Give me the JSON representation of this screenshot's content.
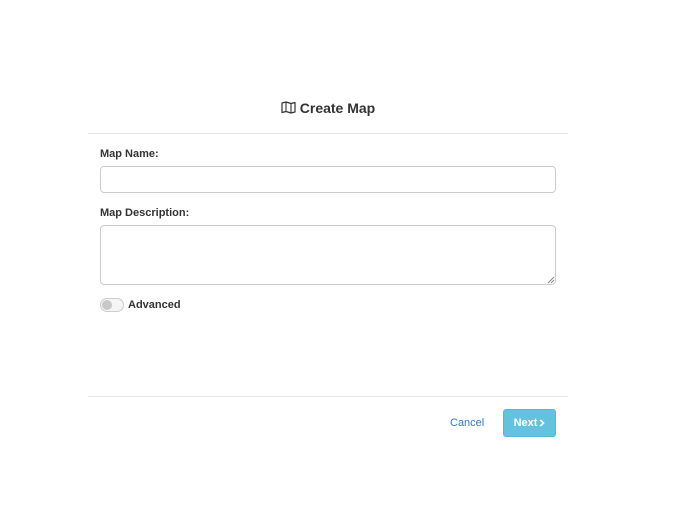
{
  "dialog": {
    "title": "Create Map",
    "title_icon": "map-icon"
  },
  "form": {
    "name_label": "Map Name:",
    "name_value": "",
    "description_label": "Map Description:",
    "description_value": "",
    "advanced_label": "Advanced",
    "advanced_enabled": false
  },
  "footer": {
    "cancel_label": "Cancel",
    "next_label": "Next",
    "next_icon": "chevron-right-icon"
  },
  "colors": {
    "primary_button": "#5bc0de",
    "link": "#337ab7"
  }
}
